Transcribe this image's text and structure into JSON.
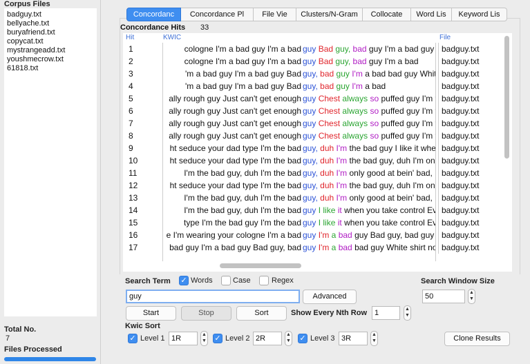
{
  "left_panel": {
    "corpus_title": "Corpus Files",
    "files": [
      "badguy.txt",
      "bellyache.txt",
      "buryafriend.txt",
      "copycat.txt",
      "mystrangeadd.txt",
      "youshmecrow.txt",
      "61818.txt"
    ],
    "total_label": "Total No.",
    "total_value": "7",
    "processed_label": "Files Processed",
    "progress": 1.0
  },
  "tabs": [
    {
      "label": "Concordanc",
      "active": true
    },
    {
      "label": "Concordance Pl",
      "active": false
    },
    {
      "label": "File Vie",
      "active": false
    },
    {
      "label": "Clusters/N-Gram",
      "active": false
    },
    {
      "label": "Collocate",
      "active": false
    },
    {
      "label": "Word Lis",
      "active": false
    },
    {
      "label": "Keyword Lis",
      "active": false
    }
  ],
  "concordance": {
    "hits_label": "Concordance Hits",
    "hits_count": "33",
    "headers": {
      "hit": "Hit",
      "kwic": "KWIC",
      "file": "File"
    },
    "colors": {
      "keyword": "#2c52d6",
      "r1": "#e0242b",
      "r2": "#2aa531",
      "r3": "#b01cc4"
    },
    "rows": [
      {
        "hit": "1",
        "left": "cologne  I'm a bad guy I'm a bad",
        "kw": "guy",
        "r1": "Bad",
        "r2": "guy,",
        "r3": "bad",
        "rest": "guy I'm a bad  guy",
        "file": "badguy.txt"
      },
      {
        "hit": "2",
        "left": "cologne   I'm a bad guy I'm a bad",
        "kw": "guy",
        "r1": "Bad",
        "r2": "guy,",
        "r3": "bad",
        "rest": "guy I'm a bad",
        "file": "badguy.txt"
      },
      {
        "hit": "3",
        "left": "'m a bad guy I'm a bad guy Bad",
        "kw": "guy,",
        "r1": "bad",
        "r2": "guy",
        "r3": "I'm",
        "rest": "a bad    bad guy   White",
        "file": "badguy.txt"
      },
      {
        "hit": "4",
        "left": "'m a bad guy I'm a bad guy Bad",
        "kw": "guy,",
        "r1": "bad",
        "r2": "guy",
        "r3": "I'm",
        "rest": "a bad",
        "file": "badguy.txt"
      },
      {
        "hit": "5",
        "left": "ally rough guy Just can't get enough",
        "kw": "guy",
        "r1": "Chest",
        "r2": "always",
        "r3": "so",
        "rest": "puffed guy I'm that",
        "file": "badguy.txt"
      },
      {
        "hit": "6",
        "left": "ally rough guy Just can't get enough",
        "kw": "guy",
        "r1": "Chest",
        "r2": "always",
        "r3": "so",
        "rest": "puffed guy I'm that",
        "file": "badguy.txt"
      },
      {
        "hit": "7",
        "left": "ally rough guy Just can't get enough",
        "kw": "guy",
        "r1": "Chest",
        "r2": "always",
        "r3": "so",
        "rest": "puffed guy I'm that",
        "file": "badguy.txt"
      },
      {
        "hit": "8",
        "left": "ally rough guy Just can't get enough",
        "kw": "guy",
        "r1": "Chest",
        "r2": "always",
        "r3": "so",
        "rest": "puffed guy I'm that",
        "file": "badguy.txt"
      },
      {
        "hit": "9",
        "left": "ht seduce your dad type I'm the bad",
        "kw": "guy,",
        "r1": "duh",
        "r2": "",
        "r3": "I'm",
        "rest": "the bad guy   I like it when",
        "file": "badguy.txt"
      },
      {
        "hit": "10",
        "left": "ht seduce your dad type I'm the bad",
        "kw": "guy,",
        "r1": "duh",
        "r2": "",
        "r3": "I'm",
        "rest": "the bad guy, duh I'm only",
        "file": "badguy.txt"
      },
      {
        "hit": "11",
        "left": "I'm the bad guy, duh  I'm the bad",
        "kw": "guy,",
        "r1": "duh",
        "r2": "",
        "r3": "I'm",
        "rest": "only good at bein' bad, bad",
        "file": "badguy.txt"
      },
      {
        "hit": "12",
        "left": "ht seduce your dad type I'm the bad",
        "kw": "guy,",
        "r1": "duh",
        "r2": "",
        "r3": "I'm",
        "rest": "the bad guy, duh I'm only",
        "file": "badguy.txt"
      },
      {
        "hit": "13",
        "left": "I'm the bad guy, duh   I'm the bad",
        "kw": "guy,",
        "r1": "duh",
        "r2": "",
        "r3": "I'm",
        "rest": "only good at bein' bad, bad",
        "file": "badguy.txt"
      },
      {
        "hit": "14",
        "left": "I'm the bad guy, duh   I'm the bad",
        "kw": "guy",
        "r1": "",
        "r2": "I like",
        "r3": "it",
        "rest": "when you take control Even",
        "file": "badguy.txt"
      },
      {
        "hit": "15",
        "left": "type I'm the bad guy I'm the bad",
        "kw": "guy",
        "r1": "",
        "r2": "I like",
        "r3": "it",
        "rest": "when you take control Even",
        "file": "badguy.txt"
      },
      {
        "hit": "16",
        "left": "e I'm wearing your cologne  I'm a bad",
        "kw": "guy",
        "r1": "I'm",
        "r2": "a",
        "r3": "bad",
        "rest": "guy Bad guy, bad guy I'm",
        "file": "badguy.txt"
      },
      {
        "hit": "17",
        "left": "bad guy I'm a bad guy Bad guy, bad",
        "kw": "guy",
        "r1": "I'm",
        "r2": "a",
        "r3": "bad",
        "rest": "bad guy   White shirt now",
        "file": "badguy.txt"
      }
    ]
  },
  "search": {
    "term_label": "Search Term",
    "words_label": "Words",
    "words_checked": true,
    "case_label": "Case",
    "case_checked": false,
    "regex_label": "Regex",
    "regex_checked": false,
    "value": "guy",
    "advanced_label": "Advanced",
    "window_size_label": "Search Window Size",
    "window_size_value": "50",
    "start_label": "Start",
    "stop_label": "Stop",
    "sort_label": "Sort",
    "nth_label": "Show Every Nth Row",
    "nth_value": "1"
  },
  "kwic_sort": {
    "label": "Kwic Sort",
    "levels": [
      {
        "label": "Level 1",
        "value": "1R",
        "checked": true
      },
      {
        "label": "Level 2",
        "value": "2R",
        "checked": true
      },
      {
        "label": "Level 3",
        "value": "3R",
        "checked": true
      }
    ],
    "clone_label": "Clone Results"
  }
}
